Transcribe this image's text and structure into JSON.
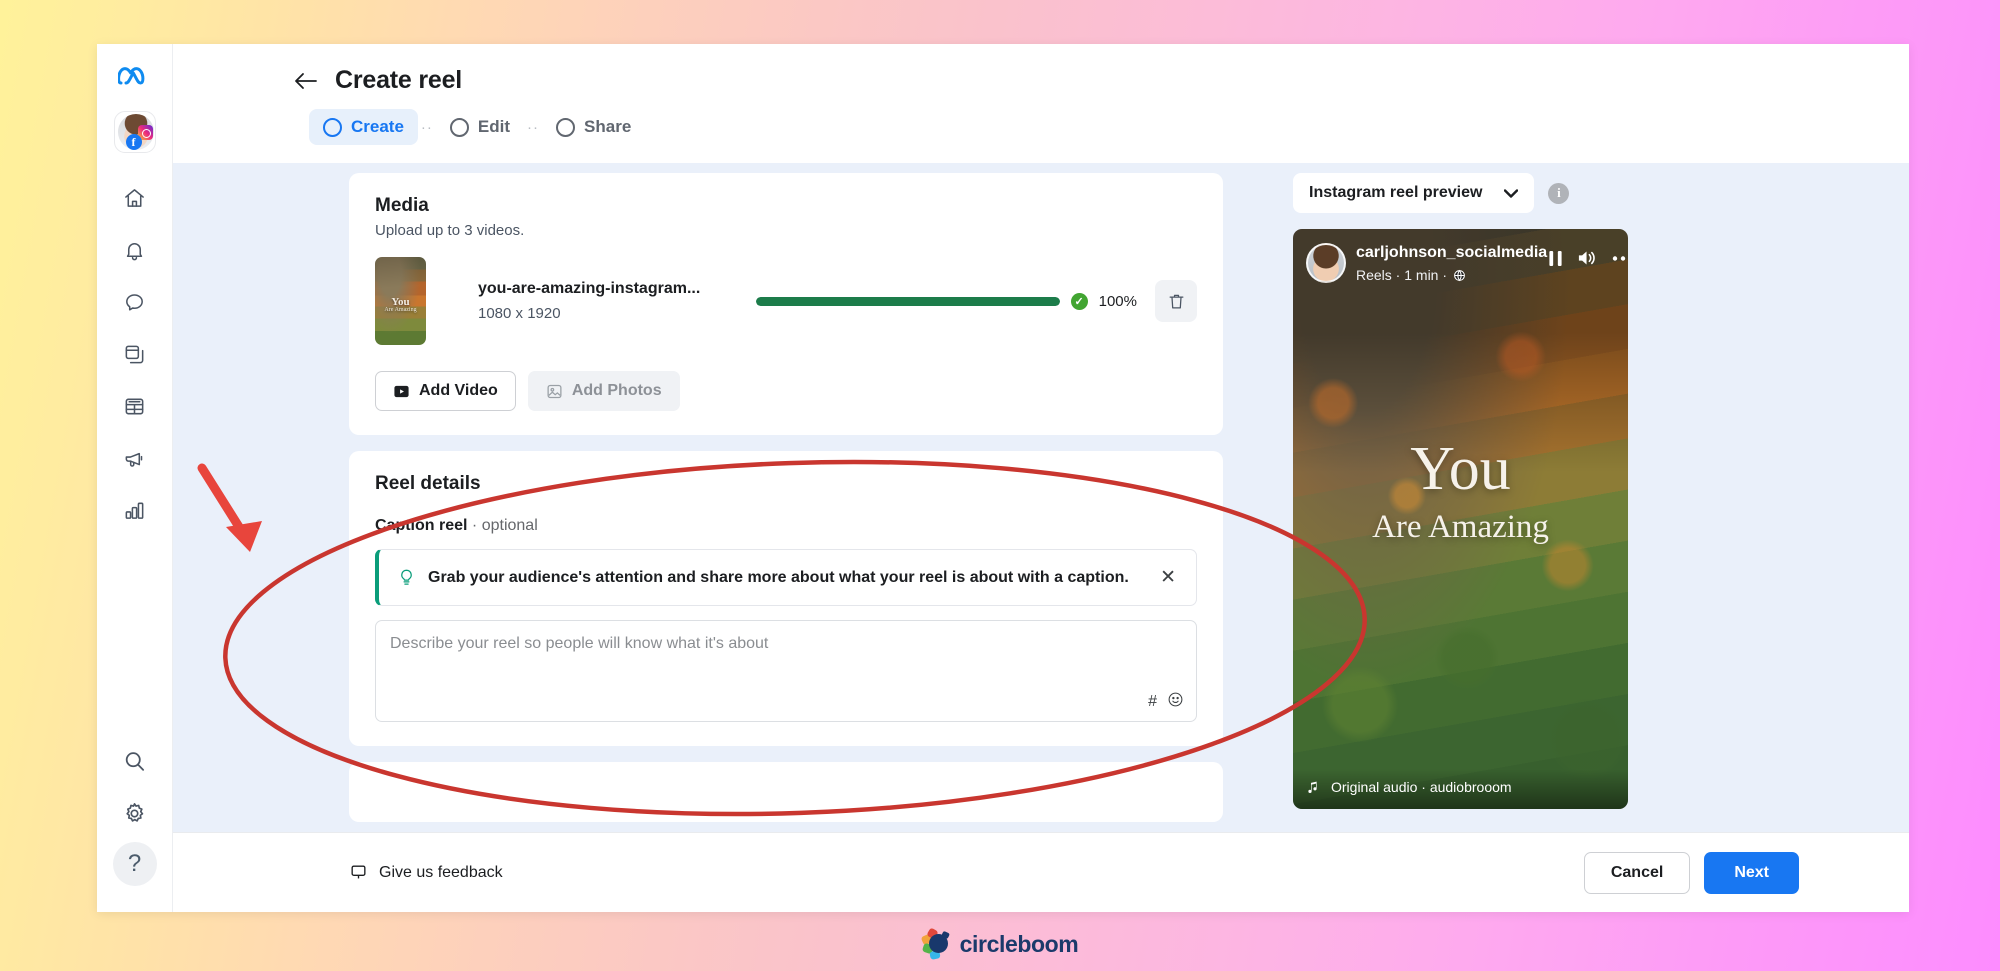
{
  "window": {
    "title": "Create reel",
    "back_icon": "back-arrow-icon"
  },
  "sidebar": {
    "logo": "meta-logo-icon",
    "account": {
      "name": "connected-account",
      "badges": [
        "instagram-icon",
        "facebook-icon"
      ]
    },
    "items": [
      {
        "name": "home",
        "icon": "home-icon"
      },
      {
        "name": "notifications",
        "icon": "bell-icon"
      },
      {
        "name": "messages",
        "icon": "chat-bubble-icon"
      },
      {
        "name": "content",
        "icon": "copy-cards-icon"
      },
      {
        "name": "planner",
        "icon": "calendar-grid-icon"
      },
      {
        "name": "ads",
        "icon": "megaphone-icon"
      },
      {
        "name": "insights",
        "icon": "bar-chart-icon"
      }
    ],
    "bottom_items": [
      {
        "name": "search",
        "icon": "search-icon"
      },
      {
        "name": "settings",
        "icon": "gear-icon"
      },
      {
        "name": "help",
        "icon": "question-mark-icon",
        "label": "?"
      }
    ]
  },
  "steps": [
    {
      "label": "Create",
      "active": true
    },
    {
      "label": "Edit",
      "active": false
    },
    {
      "label": "Share",
      "active": false
    }
  ],
  "step_separator": "··",
  "media": {
    "title": "Media",
    "subtitle": "Upload up to 3 videos.",
    "file": {
      "thumb_line1": "You",
      "thumb_line2": "Are Amazing",
      "name": "you-are-amazing-instagram...",
      "dimensions": "1080 x 1920",
      "progress": 100,
      "progress_label": "100%",
      "check_icon": "check-circle-icon",
      "delete_icon": "trash-icon"
    },
    "add_video_label": "Add Video",
    "add_video_icon": "video-play-icon",
    "add_photos_label": "Add Photos",
    "add_photos_icon": "photo-icon"
  },
  "reel_details": {
    "title": "Reel details",
    "caption_label": "Caption reel",
    "caption_optional": "· optional",
    "tip": {
      "icon": "lightbulb-icon",
      "text": "Grab your audience's attention and share more about what your reel is about with a caption.",
      "close_icon": "close-icon"
    },
    "textarea_placeholder": "Describe your reel so people will know what it's about",
    "tools": [
      {
        "name": "hashtag",
        "glyph": "#"
      },
      {
        "name": "emoji",
        "glyph": "☺"
      }
    ]
  },
  "preview": {
    "selector_label": "Instagram reel preview",
    "selector_caret": "chevron-down-icon",
    "info_icon": "info-icon",
    "info_glyph": "i",
    "account_name": "carljohnson_socialmedia",
    "meta_line": "Reels · 1 min ·",
    "globe_icon": "globe-icon",
    "controls": [
      {
        "name": "pause",
        "icon": "pause-icon"
      },
      {
        "name": "volume",
        "icon": "volume-icon"
      },
      {
        "name": "more-options",
        "icon": "ellipsis-icon"
      }
    ],
    "overlay_line1": "You",
    "overlay_line2": "Are Amazing",
    "audio_line": "Original audio · audiobrooom"
  },
  "footer": {
    "feedback_label": "Give us feedback",
    "feedback_icon": "feedback-bubble-icon",
    "cancel_label": "Cancel",
    "next_label": "Next"
  },
  "brand": {
    "name": "circleboom",
    "icon": "circleboom-logo-icon"
  },
  "annotations": {
    "ellipse": {
      "color": "#d13b3b",
      "target": "reel-details-caption-area"
    },
    "arrow": {
      "color": "#e8453c",
      "points_to": "reel-details-card"
    }
  },
  "colors": {
    "accent_blue": "#1877f2",
    "progress_green": "#1c7c4a",
    "tip_green": "#0a9d7a",
    "annotation_red": "#d13b3b"
  }
}
